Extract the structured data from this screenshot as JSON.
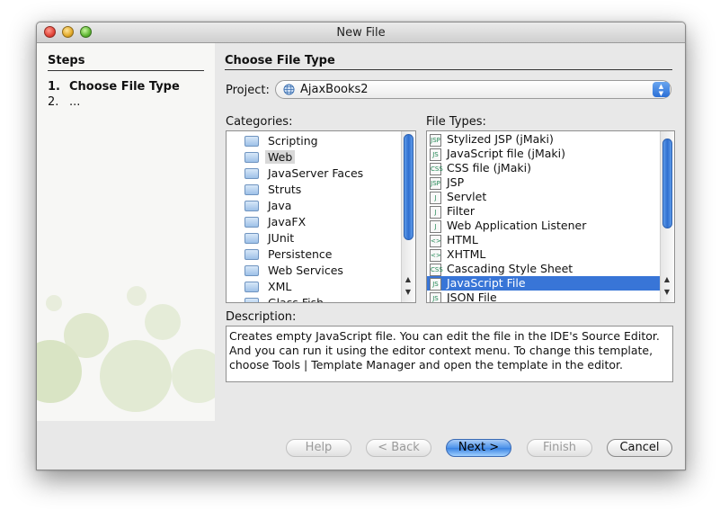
{
  "window": {
    "title": "New File"
  },
  "steps": {
    "heading": "Steps",
    "items": [
      {
        "num": "1.",
        "label": "Choose File Type"
      },
      {
        "num": "2.",
        "label": "..."
      }
    ]
  },
  "main": {
    "heading": "Choose File Type",
    "project_label": "Project:",
    "project_value": "AjaxBooks2",
    "categories_label": "Categories:",
    "file_types_label": "File Types:",
    "description_label": "Description:",
    "description_text": "Creates empty JavaScript file. You can edit the file in the IDE's Source Editor.\nAnd you can run it using the editor context menu. To change this template,\nchoose Tools | Template Manager and open the template in the editor."
  },
  "categories": [
    {
      "label": "Scripting"
    },
    {
      "label": "Web",
      "selected": true
    },
    {
      "label": "JavaServer Faces"
    },
    {
      "label": "Struts"
    },
    {
      "label": "Java"
    },
    {
      "label": "JavaFX"
    },
    {
      "label": "JUnit"
    },
    {
      "label": "Persistence"
    },
    {
      "label": "Web Services"
    },
    {
      "label": "XML"
    },
    {
      "label": "Glass Fish"
    }
  ],
  "file_types": [
    {
      "label": "Stylized JSP (jMaki)",
      "icon": "jsp-file-icon"
    },
    {
      "label": "JavaScript file (jMaki)",
      "icon": "js-file-icon"
    },
    {
      "label": "CSS file (jMaki)",
      "icon": "css-file-icon"
    },
    {
      "label": "JSP",
      "icon": "jsp-file-icon"
    },
    {
      "label": "Servlet",
      "icon": "java-file-icon"
    },
    {
      "label": "Filter",
      "icon": "java-file-icon"
    },
    {
      "label": "Web Application Listener",
      "icon": "java-file-icon"
    },
    {
      "label": "HTML",
      "icon": "html-file-icon"
    },
    {
      "label": "XHTML",
      "icon": "html-file-icon"
    },
    {
      "label": "Cascading Style Sheet",
      "icon": "css-file-icon"
    },
    {
      "label": "JavaScript File",
      "icon": "js-file-icon",
      "selected": true
    },
    {
      "label": "JSON File",
      "icon": "js-file-icon"
    }
  ],
  "buttons": {
    "help": "Help",
    "back": "< Back",
    "next": "Next >",
    "finish": "Finish",
    "cancel": "Cancel"
  },
  "colors": {
    "selection": "#3875d7",
    "default_button": "#4d93ea"
  }
}
